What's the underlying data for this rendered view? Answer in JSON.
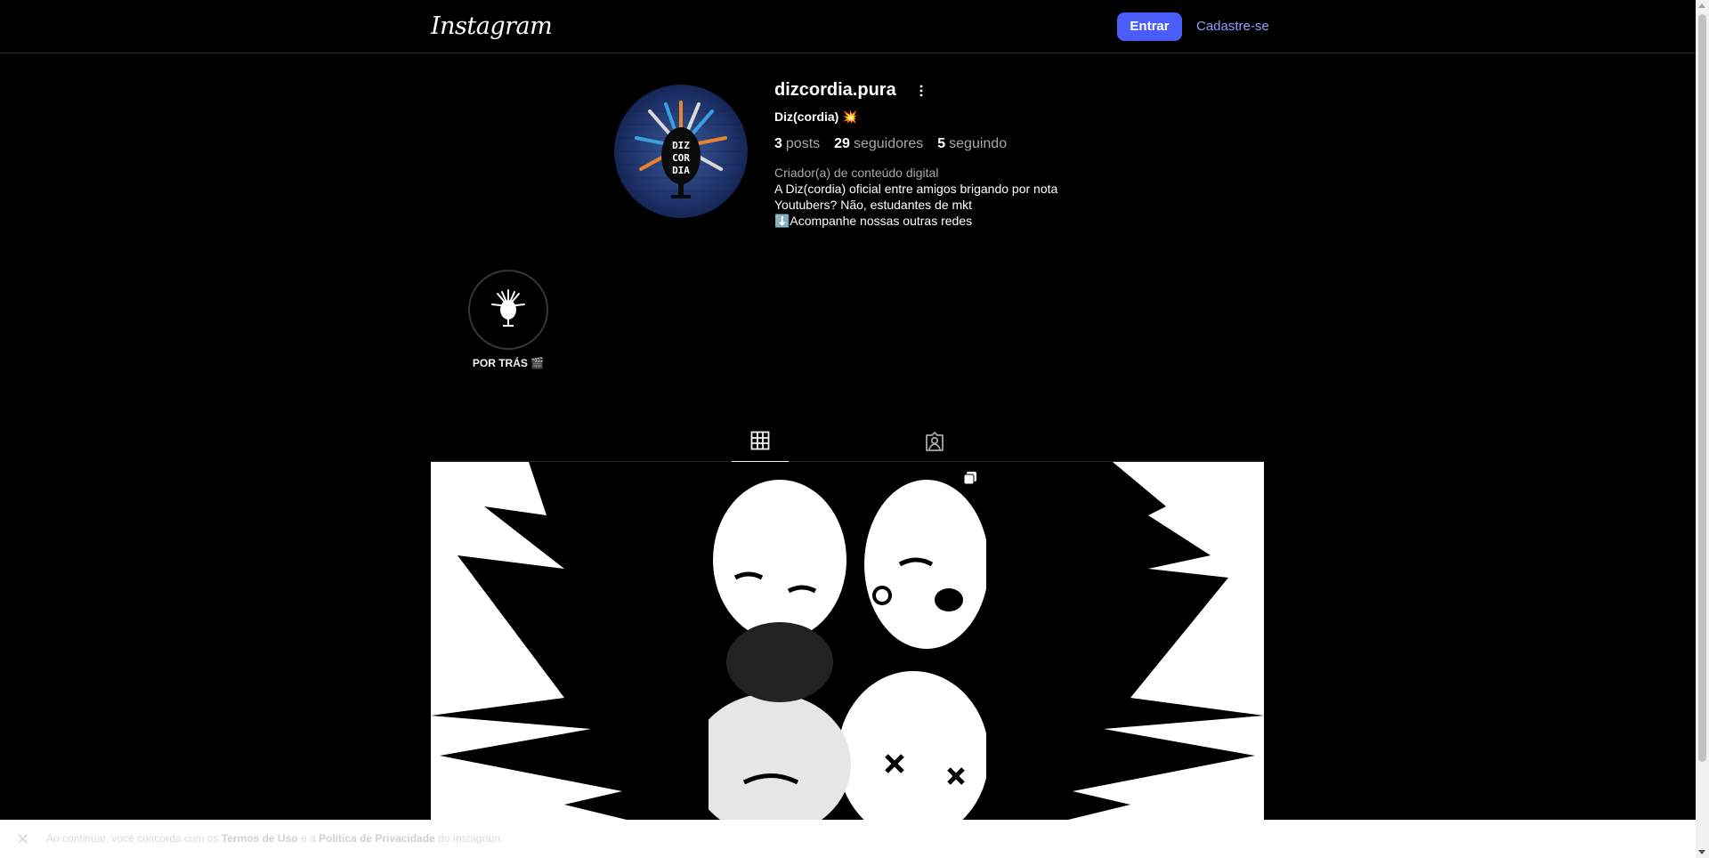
{
  "nav": {
    "logo": "Instagram",
    "login_label": "Entrar",
    "signup_label": "Cadastre-se"
  },
  "profile": {
    "username": "dizcordia.pura",
    "full_name": "Diz(cordia)",
    "full_name_emoji": "💥",
    "stats": {
      "posts_count": "3",
      "posts_label": "posts",
      "followers_count": "29",
      "followers_label": "seguidores",
      "following_count": "5",
      "following_label": "seguindo"
    },
    "category": "Criador(a) de conteúdo digital",
    "bio": [
      "A Diz(cordia) oficial entre amigos brigando por nota",
      "Youtubers? Não, estudantes de mkt",
      "⬇️Acompanhe nossas outras redes"
    ]
  },
  "highlights": [
    {
      "label": "POR TRÁS 🎬"
    }
  ],
  "tabs": [
    {
      "name": "posts",
      "icon": "grid-icon",
      "active": true
    },
    {
      "name": "tagged",
      "icon": "tagged-icon",
      "active": false
    }
  ],
  "posts": [
    {
      "icon": "none"
    },
    {
      "icon": "carousel-icon"
    },
    {
      "icon": "none"
    }
  ],
  "terms": {
    "prefix": "Ao continuar, você concorda com os",
    "terms_link": "Termos de Uso",
    "and": "e a",
    "privacy_link": "Política de Privacidade",
    "suffix": "do Instagram."
  },
  "colors": {
    "background": "#000000",
    "primary_button": "#4a5df9",
    "link": "#8f9dfb",
    "secondary_text": "#a8a8a8",
    "divider": "#262626"
  }
}
